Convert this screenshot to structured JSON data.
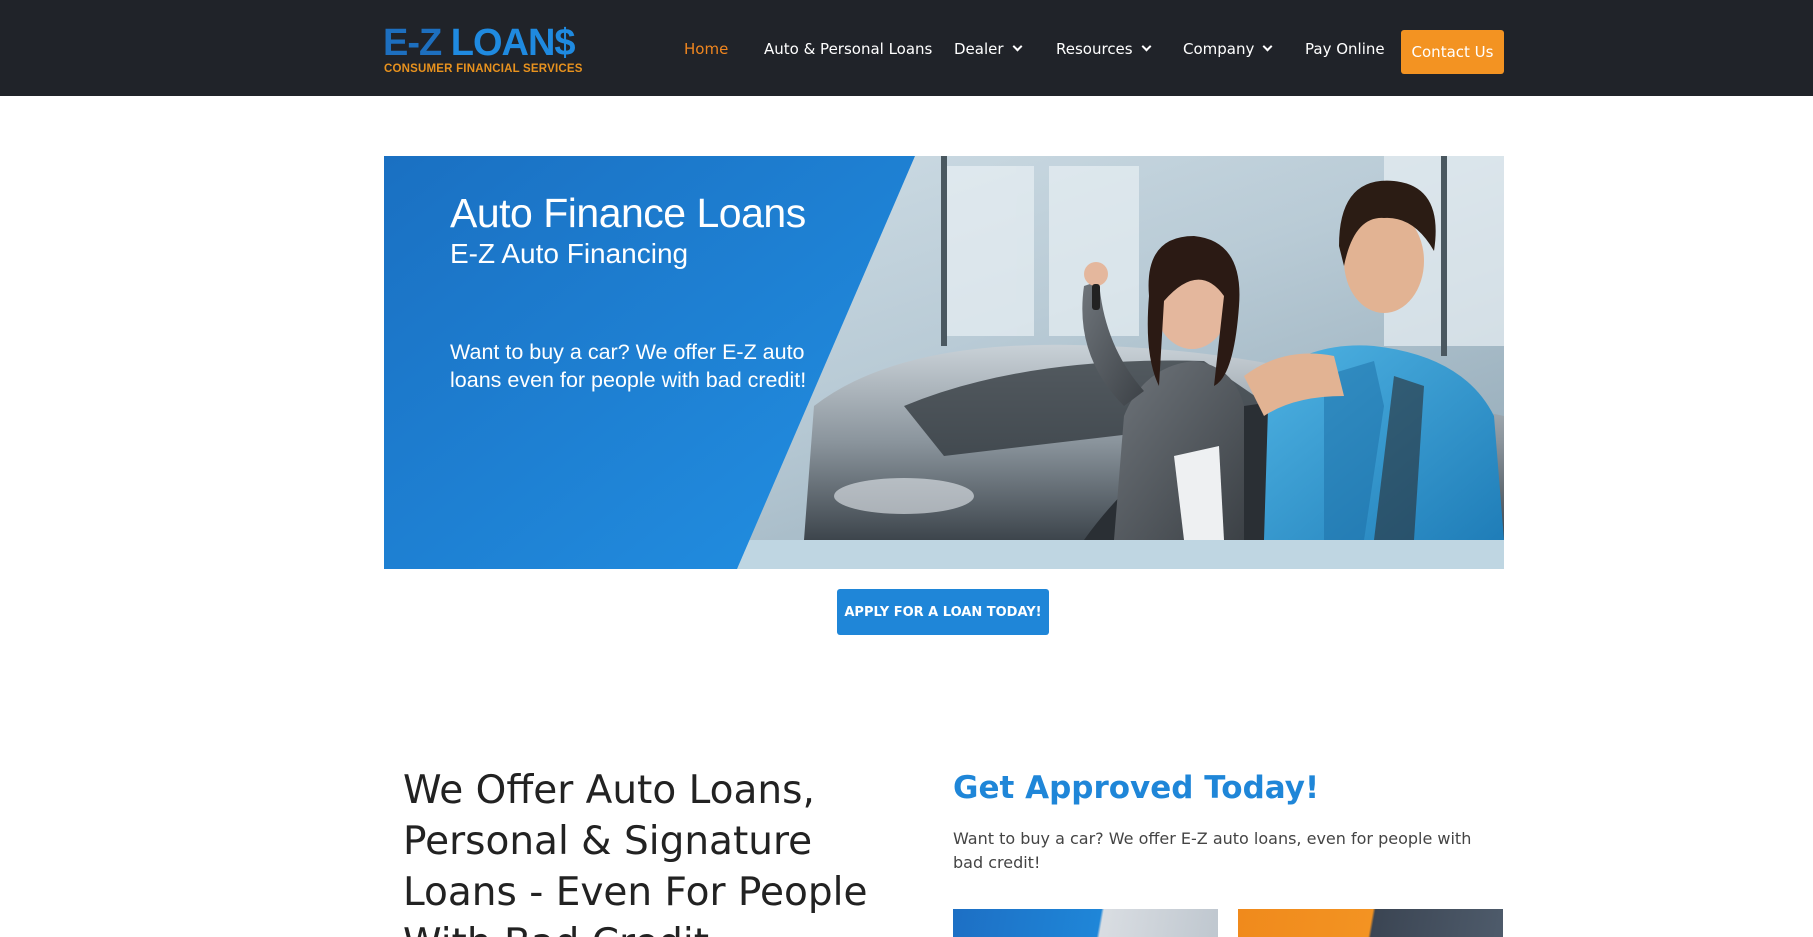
{
  "header": {
    "logo": {
      "main_left": "E-Z",
      "main_right": "LOAN$",
      "tagline": "CONSUMER FINANCIAL SERVICES"
    },
    "nav": [
      {
        "label": "Home",
        "active": true,
        "has_dropdown": false
      },
      {
        "label": "Auto & Personal Loans",
        "active": false,
        "has_dropdown": false
      },
      {
        "label": "Dealer",
        "active": false,
        "has_dropdown": true
      },
      {
        "label": "Resources",
        "active": false,
        "has_dropdown": true
      },
      {
        "label": "Company",
        "active": false,
        "has_dropdown": true
      },
      {
        "label": "Pay Online",
        "active": false,
        "has_dropdown": false
      }
    ],
    "contact_label": "Contact Us"
  },
  "hero": {
    "title": "Auto Finance Loans",
    "subtitle": "E-Z Auto Financing",
    "description": "Want to buy a car? We offer E-Z auto loans even for people with bad credit!"
  },
  "apply_button": "APPLY FOR A LOAN TODAY!",
  "offer": {
    "heading": "We Offer Auto Loans, Personal & Signature Loans - Even For People With Bad Credit"
  },
  "approved": {
    "heading": "Get Approved Today!",
    "text": "Want to buy a car? We offer E-Z auto loans, even for people with bad credit!"
  },
  "colors": {
    "header_bg": "#202329",
    "accent_orange": "#f39322",
    "accent_blue": "#1f86d8"
  }
}
